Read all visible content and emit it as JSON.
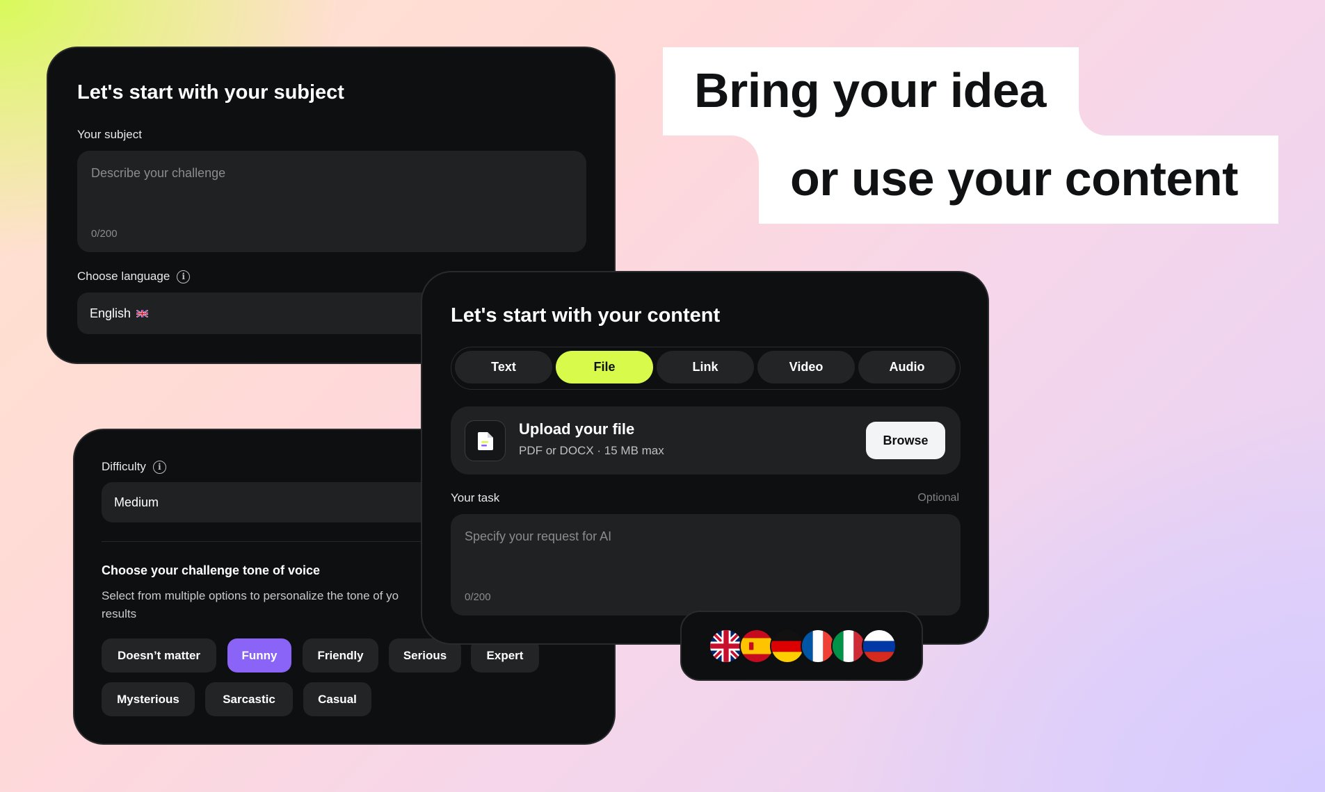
{
  "subject_card": {
    "title": "Let's start with your subject",
    "subject_label": "Your subject",
    "subject_placeholder": "Describe your challenge",
    "subject_count": "0/200",
    "language_label": "Choose language",
    "language_value": "English"
  },
  "tone_card": {
    "difficulty_label": "Difficulty",
    "difficulty_value": "Medium",
    "tone_title": "Choose your challenge tone of voice",
    "tone_desc_line1": "Select from multiple options to personalize the tone of yo",
    "tone_desc_line2": "results",
    "chips": [
      {
        "label": "Doesn’t matter",
        "active": false
      },
      {
        "label": "Funny",
        "active": true
      },
      {
        "label": "Friendly",
        "active": false
      },
      {
        "label": "Serious",
        "active": false
      },
      {
        "label": "Expert",
        "active": false
      },
      {
        "label": "Mysterious",
        "active": false
      },
      {
        "label": "Sarcastic",
        "active": false
      },
      {
        "label": "Casual",
        "active": false
      }
    ]
  },
  "headline": {
    "line1": "Bring your idea",
    "line2": "or use your content"
  },
  "content_card": {
    "title": "Let's start with your content",
    "tabs": [
      {
        "label": "Text",
        "active": false
      },
      {
        "label": "File",
        "active": true
      },
      {
        "label": "Link",
        "active": false
      },
      {
        "label": "Video",
        "active": false
      },
      {
        "label": "Audio",
        "active": false
      }
    ],
    "upload_title": "Upload your file",
    "upload_sub": "PDF or DOCX · 15 MB max",
    "browse_label": "Browse",
    "task_label": "Your task",
    "task_optional": "Optional",
    "task_placeholder": "Specify your request for AI",
    "task_count": "0/200"
  },
  "flags": [
    "uk-flag-icon",
    "spain-flag-icon",
    "germany-flag-icon",
    "france-flag-icon",
    "italy-flag-icon",
    "russia-flag-icon"
  ],
  "colors": {
    "accent_lime": "#d8fa4a",
    "accent_purple": "#8a63f7",
    "card_bg": "#0e0f10",
    "field_bg": "#1f2123"
  }
}
